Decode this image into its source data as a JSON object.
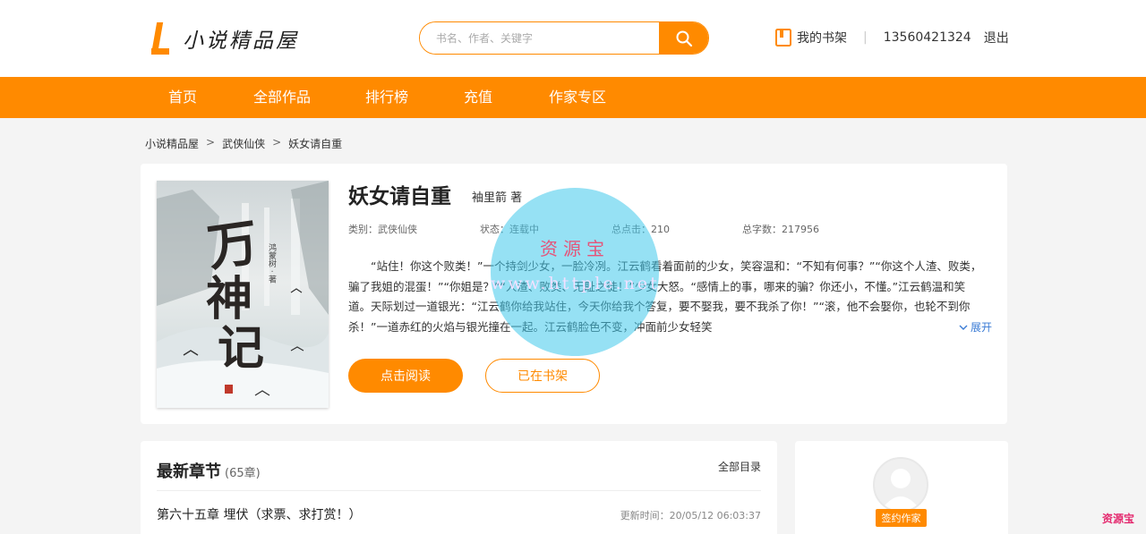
{
  "site": {
    "name": "小说精品屋"
  },
  "search": {
    "placeholder": "书名、作者、关键字"
  },
  "user": {
    "shelf_label": "我的书架",
    "separator": "|",
    "phone": "13560421324",
    "logout_label": "退出"
  },
  "nav": {
    "items": [
      "首页",
      "全部作品",
      "排行榜",
      "充值",
      "作家专区"
    ]
  },
  "breadcrumb": {
    "items": [
      "小说精品屋",
      "武侠仙侠",
      "妖女请自重"
    ],
    "separator": ">"
  },
  "book": {
    "title": "妖女请自重",
    "author": "袖里箭 著",
    "category": "类别：武侠仙侠",
    "status": "状态：连载中",
    "clicks": "总点击：210",
    "words": "总字数：217956",
    "intro": "“站住！你这个败类！”一个持剑少女，一脸冷冽。江云鹤看着面前的少女，笑容温和：“不知有何事？”“你这个人渣、败类，骗了我姐的混蛋！”“你姐是？”“人渣、败类、无耻之徒！”少女大怒。“感情上的事，哪来的骗？你还小，不懂。”江云鹤温和笑道。天际划过一道银光：“江云鹤你给我站住，今天你给我个答复，要不娶我，要不我杀了你！”“滚，他不会娶你，也轮不到你杀！”一道赤红的火焰与银光撞在一起。江云鹤脸色不变，冲面前少女轻笑",
    "expand_label": "展开",
    "read_label": "点击阅读",
    "shelf_label": "已在书架",
    "cover": {
      "text": "万神记",
      "small_text": "鸿蒙树 · 著"
    }
  },
  "watermark": {
    "title": "资源宝",
    "url": "www.httple.net"
  },
  "chapters": {
    "title": "最新章节",
    "count": "(65章)",
    "all_label": "全部目录",
    "latest": "第六十五章 埋伏（求票、求打赏！）",
    "update_time": "更新时间：20/05/12 06:03:37"
  },
  "author_card": {
    "badge": "签约作家"
  },
  "corner": {
    "text": "资源宝"
  },
  "colors": {
    "accent": "#ff8a00",
    "link": "#3a7bd5",
    "watermark_circle": "#40c8eb",
    "corner_text": "#e4296e"
  }
}
